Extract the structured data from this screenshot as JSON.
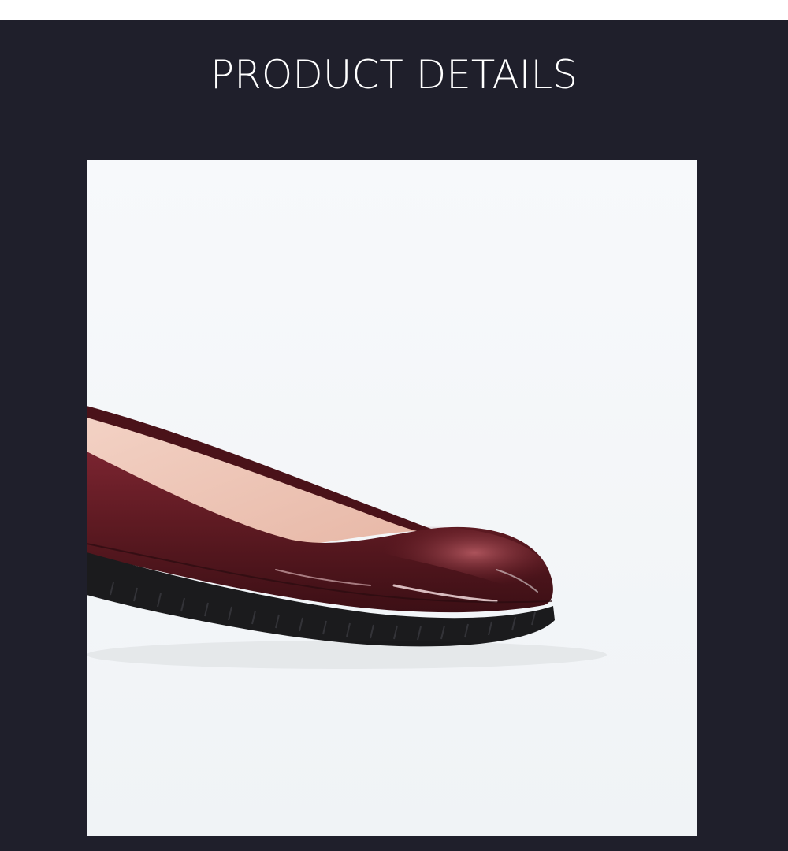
{
  "page": {
    "title": "PRODUCT DETAILS"
  },
  "product_image": {
    "subject": "shoe-icon",
    "colors": {
      "panel_background": "#1f1f2b",
      "photo_background": "#f4f6f8",
      "shoe_upper": "#6b1f28",
      "shoe_lining": "#efc5b6",
      "shoe_sole": "#1a1a1a"
    }
  }
}
